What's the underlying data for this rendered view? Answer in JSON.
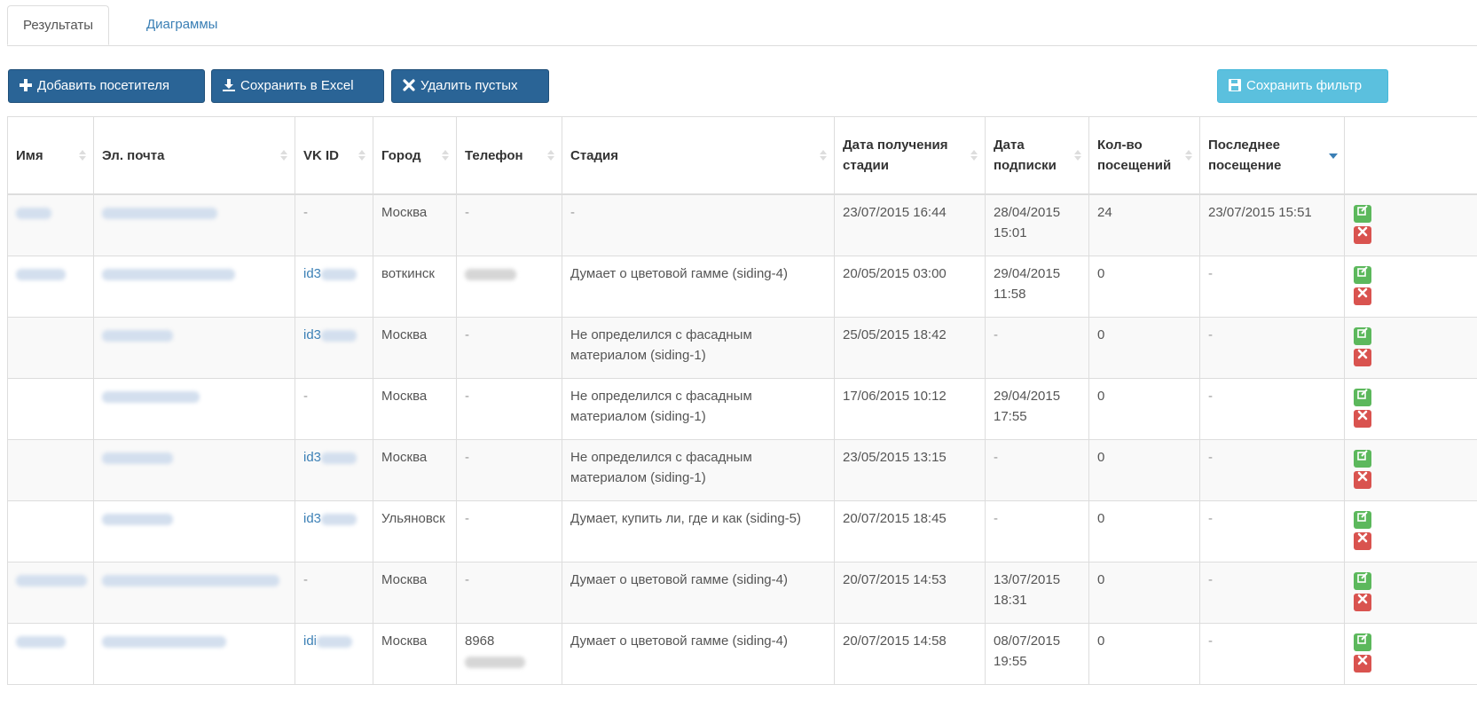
{
  "tabs": [
    "Результаты",
    "Диаграммы"
  ],
  "toolbar": {
    "add_label": "Добавить посетителя",
    "excel_label": "Сохранить в Excel",
    "delete_empty_label": "Удалить пустых",
    "save_filter_label": "Сохранить фильтр"
  },
  "table": {
    "headers": [
      "Имя",
      "Эл. почта",
      "VK ID",
      "Город",
      "Телефон",
      "Стадия",
      "Дата получения стадии",
      "Дата подписки",
      "Кол-во посещений",
      "Последнее посещение"
    ],
    "sorted_column": "Последнее посещение",
    "sort_direction": "desc",
    "rows": [
      {
        "vk": "-",
        "city": "Москва",
        "phone": "-",
        "stage": "-",
        "stage_date": "23/07/2015 16:44",
        "sub_date": "28/04/2015 15:01",
        "visits": "24",
        "last": "23/07/2015 15:51"
      },
      {
        "vk": "id3",
        "city": "воткинск",
        "phone": "",
        "stage": "Думает о цветовой гамме (siding-4)",
        "stage_date": "20/05/2015 03:00",
        "sub_date": "29/04/2015 11:58",
        "visits": "0",
        "last": "-"
      },
      {
        "vk": "id3",
        "city": "Москва",
        "phone": "-",
        "stage": "Не определился с фасадным материалом (siding-1)",
        "stage_date": "25/05/2015 18:42",
        "sub_date": "-",
        "visits": "0",
        "last": "-"
      },
      {
        "vk": "-",
        "city": "Москва",
        "phone": "-",
        "stage": "Не определился с фасадным материалом (siding-1)",
        "stage_date": "17/06/2015 10:12",
        "sub_date": "29/04/2015 17:55",
        "visits": "0",
        "last": "-"
      },
      {
        "vk": "id3",
        "city": "Москва",
        "phone": "-",
        "stage": "Не определился с фасадным материалом (siding-1)",
        "stage_date": "23/05/2015 13:15",
        "sub_date": "-",
        "visits": "0",
        "last": "-"
      },
      {
        "vk": "id3",
        "city": "Ульяновск",
        "phone": "-",
        "stage": "Думает, купить ли, где и как (siding-5)",
        "stage_date": "20/07/2015 18:45",
        "sub_date": "-",
        "visits": "0",
        "last": "-"
      },
      {
        "vk": "-",
        "city": "Москва",
        "phone": "-",
        "stage": "Думает о цветовой гамме (siding-4)",
        "stage_date": "20/07/2015 14:53",
        "sub_date": "13/07/2015 18:31",
        "visits": "0",
        "last": "-"
      },
      {
        "vk": "idi",
        "city": "Москва",
        "phone": "8968",
        "stage": "Думает о цветовой гамме (siding-4)",
        "stage_date": "20/07/2015 14:58",
        "sub_date": "08/07/2015 19:55",
        "visits": "0",
        "last": "-"
      }
    ]
  },
  "icons": {
    "add": "plus-icon",
    "excel": "download-icon",
    "delete_empty": "x-icon",
    "save_filter": "floppy-disk-icon",
    "row_edit": "edit-icon",
    "row_delete": "delete-icon",
    "sort": "sort-icon"
  },
  "colors": {
    "primary": "#2a6496",
    "info": "#5bc0de",
    "link": "#3a7fb5",
    "success": "#5cb85c",
    "danger": "#d9534f"
  }
}
